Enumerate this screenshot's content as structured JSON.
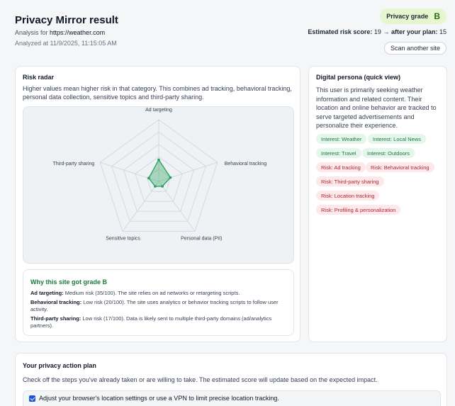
{
  "header": {
    "title": "Privacy Mirror result",
    "analysis_prefix": "Analysis for ",
    "url": "https://weather.com",
    "analyzed_at": "Analyzed at 11/9/2025, 11:15:05 AM",
    "grade_label": "Privacy grade",
    "grade": "B",
    "risk_prefix": "Estimated risk score:",
    "risk_value": "19",
    "arrow": "→",
    "after_label": "after your plan:",
    "after_value": "15",
    "scan_button": "Scan another site"
  },
  "radar": {
    "title": "Risk radar",
    "description": "Higher values mean higher risk in that category. This combines ad tracking, behavioral tracking, personal data collection, sensitive topics and third-party sharing.",
    "accent_color": "#22a05a",
    "axes": [
      {
        "label": "Ad targeting",
        "value": 35
      },
      {
        "label": "Behavioral tracking",
        "value": 20
      },
      {
        "label": "Personal data (PII)",
        "value": 10
      },
      {
        "label": "Sensitive topics",
        "value": 10
      },
      {
        "label": "Third-party sharing",
        "value": 17
      }
    ],
    "max": 100
  },
  "why": {
    "title": "Why this site got grade B",
    "items": [
      {
        "name": "Ad targeting:",
        "text": "Medium risk (35/100). The site relies on ad networks or retargeting scripts."
      },
      {
        "name": "Behavioral tracking:",
        "text": "Low risk (20/100). The site uses analytics or behavior tracking scripts to follow user activity."
      },
      {
        "name": "Third-party sharing:",
        "text": "Low risk (17/100). Data is likely sent to multiple third-party domains (ad/analytics partners)."
      }
    ]
  },
  "persona": {
    "title": "Digital persona (quick view)",
    "description": "This user is primarily seeking weather information and related content. Their location and online behavior are tracked to serve targeted advertisements and personalize their experience.",
    "tags": [
      {
        "label": "Interest: Weather",
        "kind": "interest"
      },
      {
        "label": "Interest: Local News",
        "kind": "interest"
      },
      {
        "label": "Interest: Travel",
        "kind": "interest"
      },
      {
        "label": "Interest: Outdoors",
        "kind": "interest"
      },
      {
        "label": "Risk: Ad tracking",
        "kind": "risk"
      },
      {
        "label": "Risk: Behavioral tracking",
        "kind": "risk"
      },
      {
        "label": "Risk: Third-party sharing",
        "kind": "risk"
      },
      {
        "label": "Risk: Location tracking",
        "kind": "risk"
      },
      {
        "label": "Risk: Profiling & personalization",
        "kind": "risk"
      }
    ]
  },
  "plan": {
    "title": "Your privacy action plan",
    "description": "Check off the steps you've already taken or are willing to take. The estimated score will update based on the expected impact.",
    "items": [
      {
        "label": "Adjust your browser's location settings or use a VPN to limit precise location tracking.",
        "checked": true
      }
    ]
  }
}
